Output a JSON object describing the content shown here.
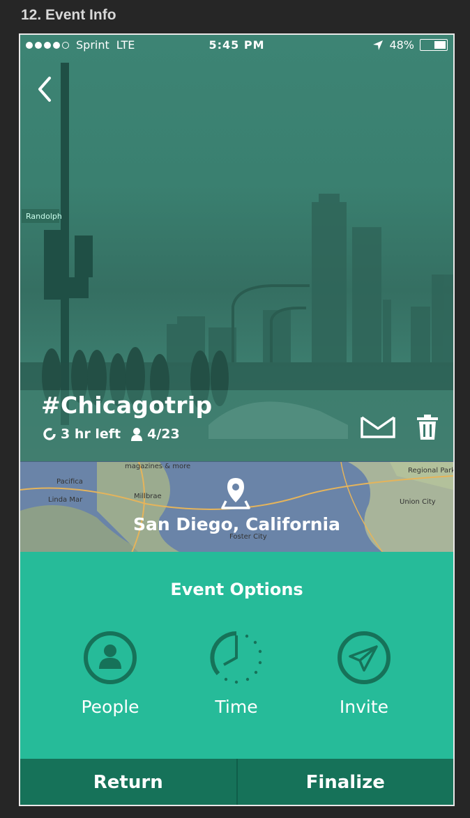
{
  "page_label": "12. Event Info",
  "status_bar": {
    "carrier": "Sprint",
    "network": "LTE",
    "time": "5:45 PM",
    "battery": "48%",
    "battery_level": 0.48
  },
  "event": {
    "title": "#Chicagotrip",
    "time_left": "3 hr left",
    "attendees": "4/23"
  },
  "map": {
    "location": "San Diego, California"
  },
  "options": {
    "title": "Event Options",
    "items": [
      {
        "label": "People",
        "icon": "person-icon"
      },
      {
        "label": "Time",
        "icon": "clock-icon"
      },
      {
        "label": "Invite",
        "icon": "paper-plane-icon"
      }
    ]
  },
  "bottom": {
    "return_label": "Return",
    "finalize_label": "Finalize"
  },
  "colors": {
    "accent": "#26bb99",
    "accent_dark": "#167259",
    "hero_tint": "#3d8474",
    "icon_dark": "#167259"
  }
}
